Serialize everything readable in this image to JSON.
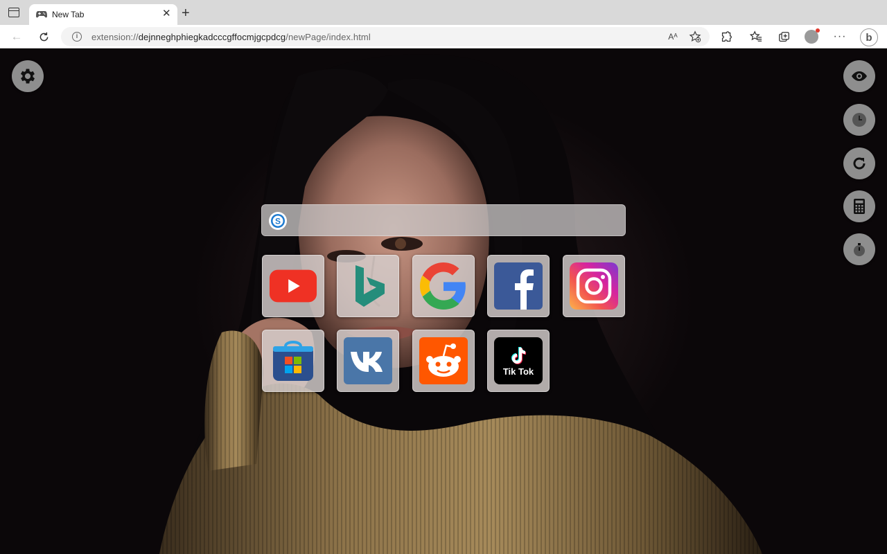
{
  "browser": {
    "tab_title": "New Tab",
    "url_scheme": "extension://",
    "url_host": "dejnneghphiegkadcccgffocmjgcpdcg",
    "url_path": "/newPage/index.html"
  },
  "toolbar_icons": [
    "back-arrow-icon",
    "refresh-icon",
    "info-icon",
    "read-aloud-icon",
    "add-favorite-icon",
    "extensions-icon",
    "favorites-icon",
    "collections-icon",
    "profile-avatar",
    "more-icon",
    "bing-icon"
  ],
  "page": {
    "search": {
      "placeholder": "",
      "value": ""
    },
    "shortcuts": [
      {
        "name": "YouTube",
        "icon": "youtube-icon",
        "color": "#ef3124"
      },
      {
        "name": "Bing",
        "icon": "bing-icon",
        "color": "#258d7b"
      },
      {
        "name": "Google",
        "icon": "google-icon",
        "color": "#4285f4"
      },
      {
        "name": "Facebook",
        "icon": "facebook-icon",
        "color": "#3b5998"
      },
      {
        "name": "Instagram",
        "icon": "instagram-icon",
        "color": "#d6249f"
      },
      {
        "name": "Microsoft Store",
        "icon": "microsoft-store-icon",
        "color": "#2b4f8e"
      },
      {
        "name": "VK",
        "icon": "vk-icon",
        "color": "#4a76a8"
      },
      {
        "name": "Reddit",
        "icon": "reddit-icon",
        "color": "#ff5700"
      },
      {
        "name": "TikTok",
        "icon": "tiktok-icon",
        "color": "#000000",
        "label": "Tik Tok"
      }
    ],
    "side_tools": [
      "eye-icon",
      "clock-icon",
      "refresh-icon",
      "calculator-icon",
      "stopwatch-icon"
    ]
  }
}
